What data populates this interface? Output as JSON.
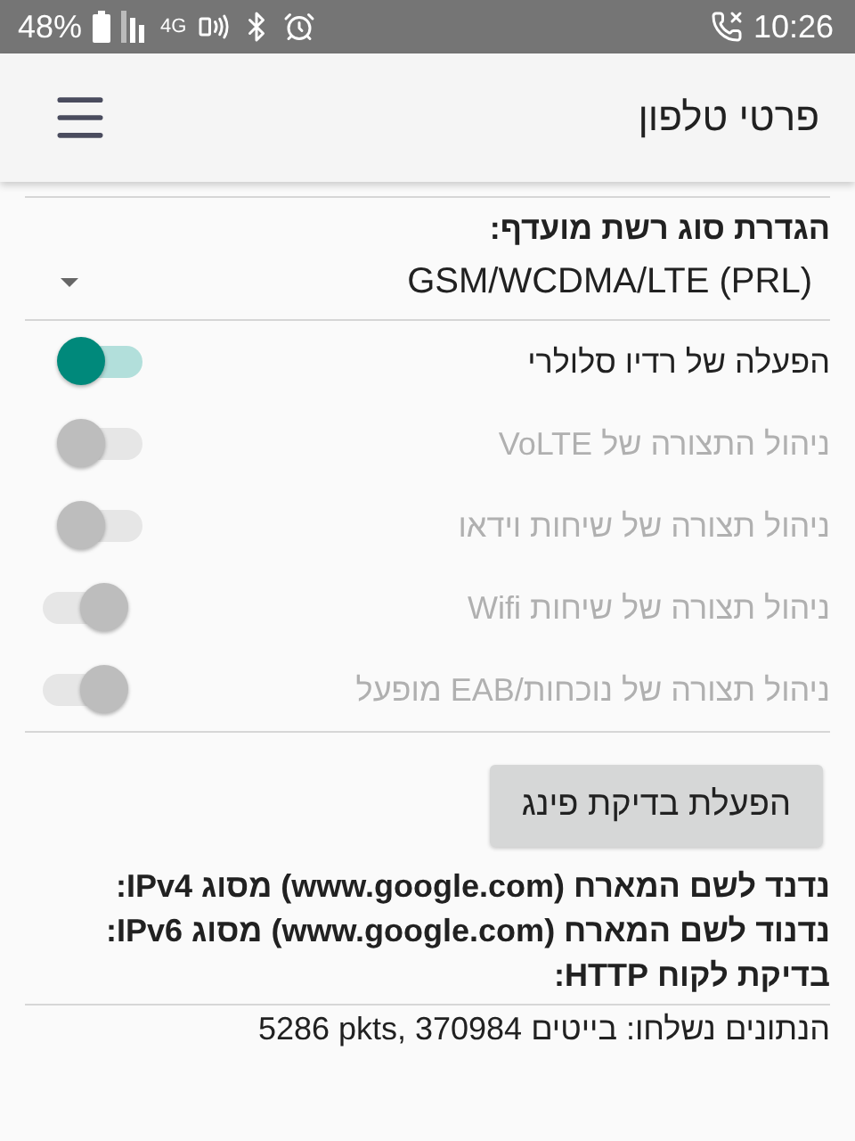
{
  "status_bar": {
    "battery": "48%",
    "network": "4G",
    "time": "10:26"
  },
  "app_bar": {
    "title": "פרטי טלפון"
  },
  "network_type": {
    "label": "הגדרת סוג רשת מועדף:",
    "value": "GSM/WCDMA/LTE (PRL)"
  },
  "switches": [
    {
      "label": "הפעלה של רדיו סלולרי",
      "checked": true,
      "disabled": false
    },
    {
      "label": "ניהול התצורה של VoLTE",
      "checked": true,
      "disabled": true
    },
    {
      "label": "ניהול תצורה של שיחות וידאו",
      "checked": true,
      "disabled": true
    },
    {
      "label": "ניהול תצורה של שיחות Wifi",
      "checked": false,
      "disabled": true
    },
    {
      "label": "ניהול תצורה של נוכחות/EAB מופעל",
      "checked": false,
      "disabled": true
    }
  ],
  "ping_button": "הפעלת בדיקת פינג",
  "results": [
    "נדנד לשם המארח (www.google.com) מסוג IPv4:",
    "נדנוד לשם המארח (www.google.com) מסוג IPv6:",
    "בדיקת לקוח HTTP:"
  ],
  "data_sent": "הנתונים נשלחו: בייטים 5286 pkts, 370984"
}
